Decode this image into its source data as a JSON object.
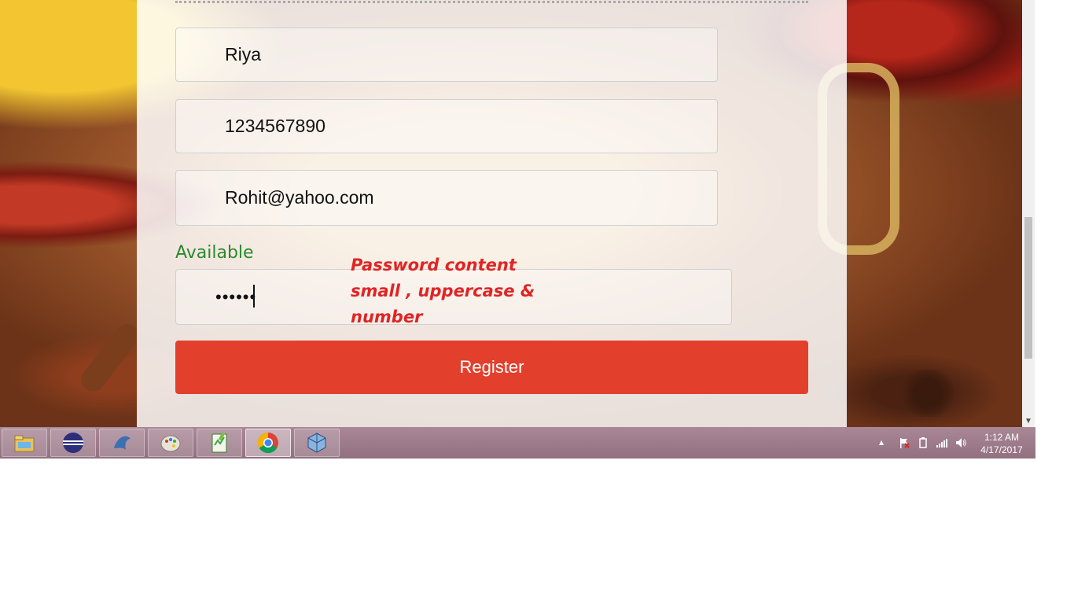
{
  "form": {
    "name_value": "Riya",
    "phone_value": "1234567890",
    "email_value": "Rohit@yahoo.com",
    "availability_status": "Available",
    "password_masked": "••••••",
    "password_hint": "Password content small , uppercase & number",
    "register_label": "Register"
  },
  "colors": {
    "register_button": "#e2402d",
    "available_text": "#2b8a2b",
    "hint_text": "#e02424",
    "taskbar": "#9c7a89"
  },
  "taskbar": {
    "items": [
      {
        "icon": "file-explorer-icon"
      },
      {
        "icon": "eclipse-icon"
      },
      {
        "icon": "mysql-dolphin-icon"
      },
      {
        "icon": "paint-palette-icon"
      },
      {
        "icon": "notepad-plus-plus-icon"
      },
      {
        "icon": "chrome-icon",
        "active": true
      },
      {
        "icon": "virtualbox-icon"
      }
    ],
    "tray_icons": [
      "show-hidden-icons-arrow",
      "action-center-flag-icon",
      "power-icon",
      "network-signal-icon",
      "volume-icon"
    ],
    "clock_time": "1:12 AM",
    "clock_date": "4/17/2017"
  }
}
